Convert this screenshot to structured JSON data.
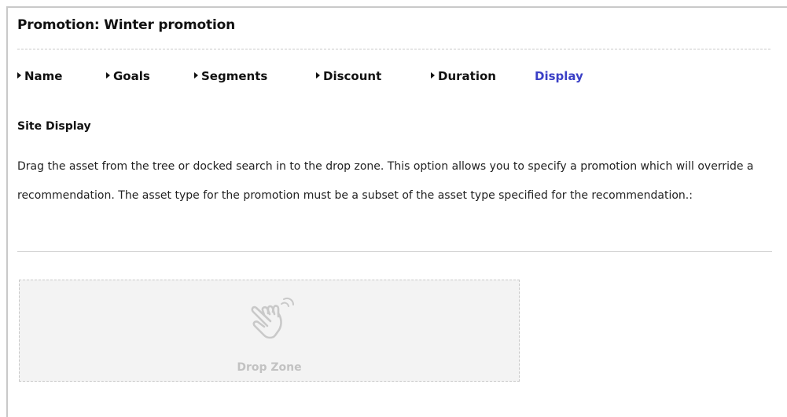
{
  "header": {
    "title": "Promotion: Winter promotion"
  },
  "steps": [
    {
      "label": "Name",
      "active": false
    },
    {
      "label": "Goals",
      "active": false
    },
    {
      "label": "Segments",
      "active": false
    },
    {
      "label": "Discount",
      "active": false
    },
    {
      "label": "Duration",
      "active": false
    },
    {
      "label": "Display",
      "active": true
    }
  ],
  "section": {
    "heading": "Site Display",
    "description": "Drag the asset from the tree or docked search in to the drop zone. This option allows you to specify a promotion which will override a recommendation. The asset type for the promotion must be a subset of the asset type specified for the recommendation.:"
  },
  "drop_zone": {
    "icon": "hand-pointer-icon",
    "label": "Drop Zone"
  },
  "colors": {
    "active_step": "#3a3fc6",
    "drop_zone_bg": "#f3f3f3",
    "drop_zone_text": "#c2c2c2"
  }
}
